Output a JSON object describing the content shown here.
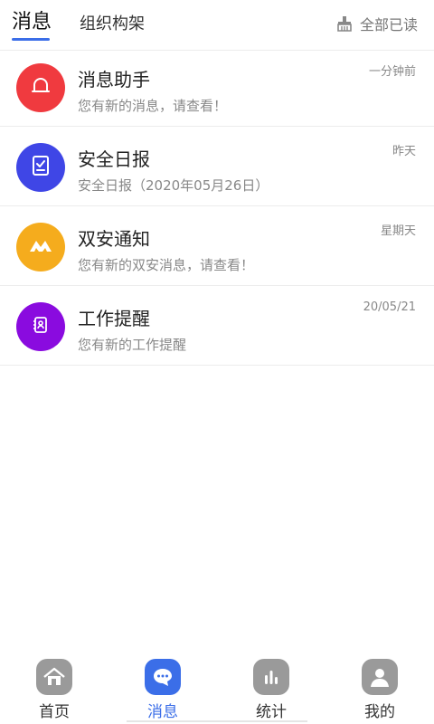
{
  "header": {
    "tab_active": "消息",
    "tab_other": "组织构架",
    "mark_all_read": "全部已读"
  },
  "messages": [
    {
      "title": "消息助手",
      "subtitle": "您有新的消息，请查看！",
      "time": "一分钟前",
      "icon": "bell-icon",
      "color": "#f03a3f"
    },
    {
      "title": "安全日报",
      "subtitle": "安全日报（2020年05月26日）",
      "time": "昨天",
      "icon": "report-check-icon",
      "color": "#3f46e6"
    },
    {
      "title": "双安通知",
      "subtitle": "您有新的双安消息，请查看！",
      "time": "星期天",
      "icon": "mountain-logo-icon",
      "color": "#f5ac1d"
    },
    {
      "title": "工作提醒",
      "subtitle": "您有新的工作提醒",
      "time": "20/05/21",
      "icon": "contact-book-icon",
      "color": "#8a0bdf"
    }
  ],
  "nav": {
    "items": [
      {
        "label": "首页",
        "icon": "home-icon",
        "active": false
      },
      {
        "label": "消息",
        "icon": "chat-bubble-icon",
        "active": true
      },
      {
        "label": "统计",
        "icon": "bar-chart-icon",
        "active": false
      },
      {
        "label": "我的",
        "icon": "user-icon",
        "active": false
      }
    ]
  },
  "colors": {
    "accent": "#3b6ee8",
    "nav_inactive_icon": "#9a9a9a"
  }
}
